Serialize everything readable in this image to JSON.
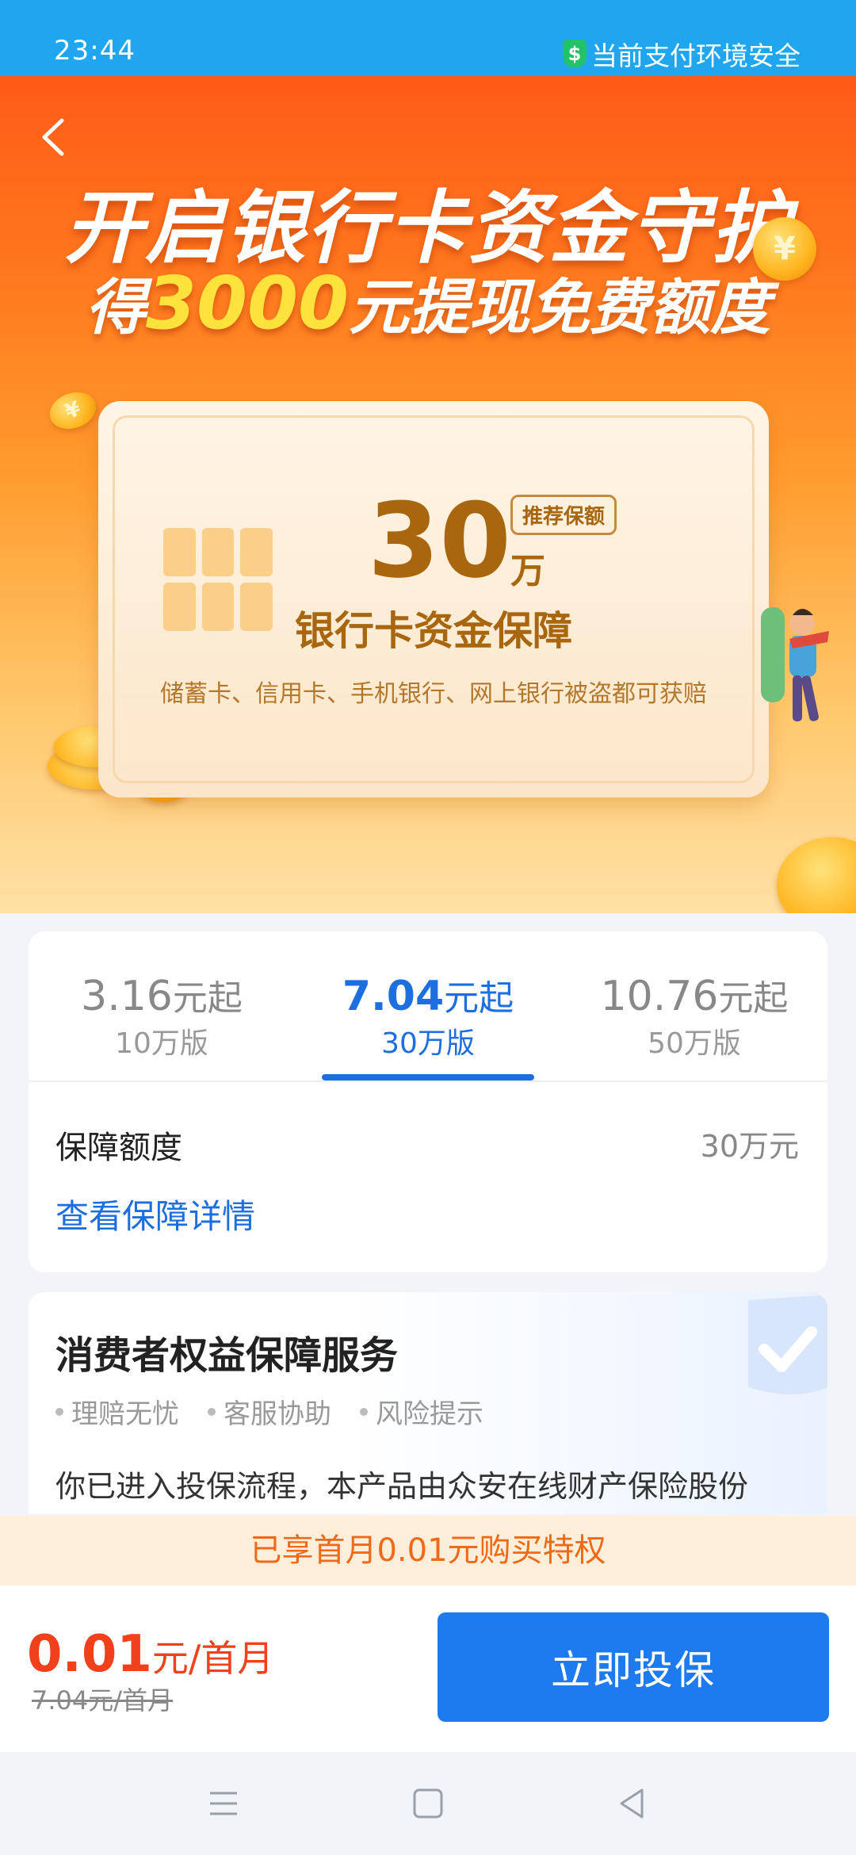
{
  "status_bar": {
    "time": "23:44",
    "secure_text": "当前支付环境安全"
  },
  "hero": {
    "title_line1": "开启银行卡资金守护",
    "title_line2_prefix": "得",
    "title_line2_amount": "3000",
    "title_line2_suffix": "元提现免费额度",
    "card": {
      "amount": "30",
      "amount_unit": "万",
      "badge": "推荐保额",
      "title": "银行卡资金保障",
      "description": "储蓄卡、信用卡、手机银行、网上银行被盗都可获赔"
    }
  },
  "plans": {
    "tabs": [
      {
        "price": "3.16",
        "price_unit": "元起",
        "version": "10万版"
      },
      {
        "price": "7.04",
        "price_unit": "元起",
        "version": "30万版"
      },
      {
        "price": "10.76",
        "price_unit": "元起",
        "version": "50万版"
      }
    ],
    "active_index": 1,
    "coverage_label": "保障额度",
    "coverage_value": "30万元",
    "detail_link": "查看保障详情"
  },
  "rights": {
    "title": "消费者权益保障服务",
    "tags": [
      "理赔无忧",
      "客服协助",
      "风险提示"
    ],
    "description": "你已进入投保流程，本产品由众安在线财产保险股份"
  },
  "privilege_text": "已享首月0.01元购买特权",
  "action_bar": {
    "price": "0.01",
    "price_unit": "元/首月",
    "original_price": "7.04元/首月",
    "buy_label": "立即投保"
  },
  "colors": {
    "accent_blue": "#1d7bef",
    "price_red": "#f0401c",
    "status_bar": "#1fa6ef"
  }
}
